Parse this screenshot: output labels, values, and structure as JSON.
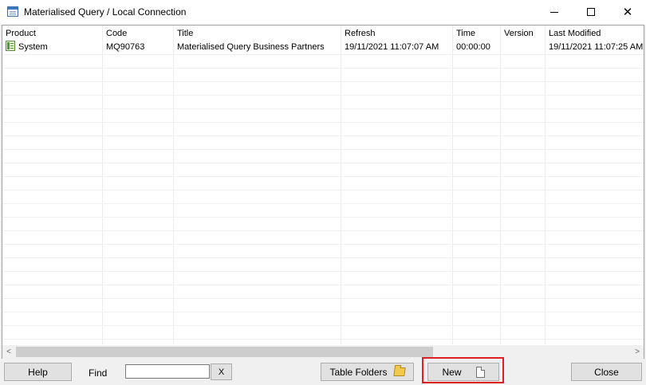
{
  "window": {
    "title": "Materialised Query / Local Connection",
    "controls": {
      "minimize": "",
      "maximize": "",
      "close": "✕"
    }
  },
  "table": {
    "columns": [
      "Product",
      "Code",
      "Title",
      "Refresh",
      "Time",
      "Version",
      "Last Modified"
    ],
    "rows": [
      {
        "product": "System",
        "code": "MQ90763",
        "title": "Materialised Query Business Partners",
        "refresh": "19/11/2021 11:07:07 AM",
        "time": "00:00:00",
        "version": "",
        "last_modified": "19/11/2021 11:07:25 AM",
        "icon": "table-icon"
      }
    ]
  },
  "scrollbar": {
    "left_arrow": "<",
    "right_arrow": ">"
  },
  "footer": {
    "help_label": "Help",
    "find_label": "Find",
    "find_value": "",
    "clear_label": "X",
    "table_folders_label": "Table Folders",
    "new_label": "New",
    "close_label": "Close"
  },
  "colors": {
    "highlight": "#e02020",
    "button_face": "#e1e1e1",
    "window_bg": "#f0f0f0"
  },
  "icons": {
    "app": "window-icon",
    "row": "table-icon",
    "folders": "folder-icon",
    "new": "document-icon"
  }
}
